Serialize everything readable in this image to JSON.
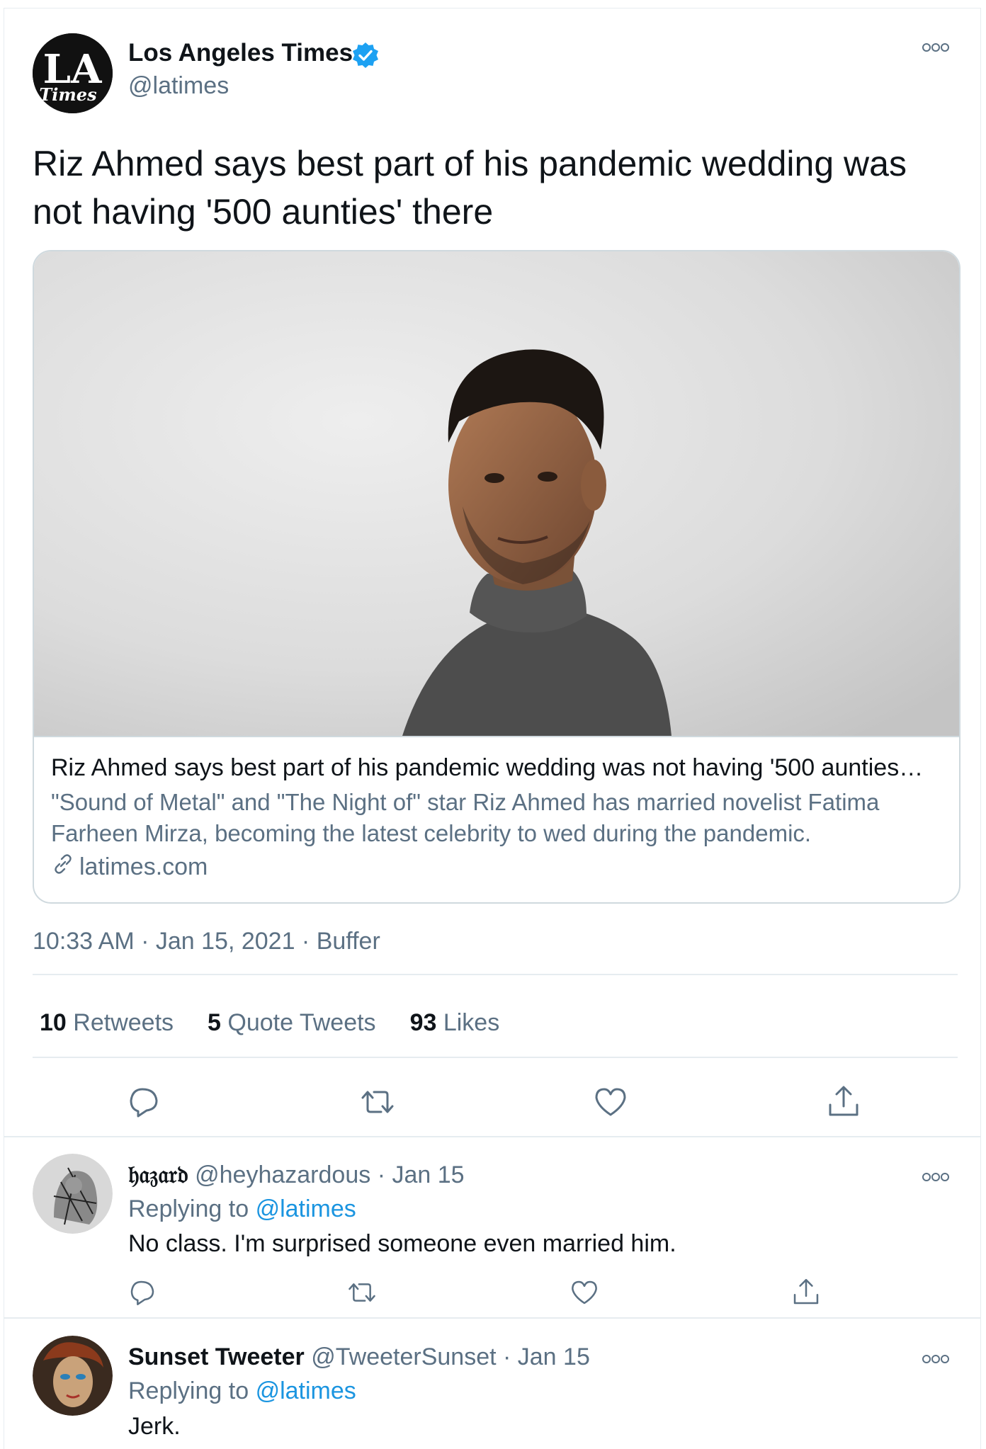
{
  "main_tweet": {
    "author_name": "Los Angeles Times",
    "author_handle": "@latimes",
    "avatar_text": {
      "line1": "LA",
      "line2": "Times"
    },
    "text": "Riz Ahmed says best part of his pandemic wedding was not having '500 aunties' there",
    "card": {
      "title": "Riz Ahmed says best part of his pandemic wedding was not having '500 aunties…",
      "description": "\"Sound of Metal\" and \"The Night of\" star Riz Ahmed has married novelist Fatima Farheen Mirza, becoming the latest celebrity to wed during the pandemic.",
      "domain": "latimes.com"
    },
    "timestamp": "10:33 AM · Jan 15, 2021 · Buffer",
    "stats": {
      "retweets_count": "10",
      "retweets_label": "Retweets",
      "quotes_count": "5",
      "quotes_label": "Quote Tweets",
      "likes_count": "93",
      "likes_label": "Likes"
    }
  },
  "replies": [
    {
      "name": "𝔥𝔞𝔷𝔞𝔯𝔡",
      "handle": "@heyhazardous",
      "date": "· Jan 15",
      "replying_prefix": "Replying to",
      "replying_to": "@latimes",
      "text": "No class. I'm surprised someone even married him."
    },
    {
      "name": "Sunset Tweeter",
      "handle": "@TweeterSunset",
      "date": "· Jan 15",
      "replying_prefix": "Replying to",
      "replying_to": "@latimes",
      "text": "Jerk."
    }
  ],
  "colors": {
    "verified": "#1da1f2",
    "link": "#1b95e0",
    "muted": "#5b7083",
    "border": "#e6ecf0"
  },
  "icons": [
    "verified-icon",
    "more-icon",
    "link-icon",
    "reply-icon",
    "retweet-icon",
    "like-icon",
    "share-icon"
  ]
}
